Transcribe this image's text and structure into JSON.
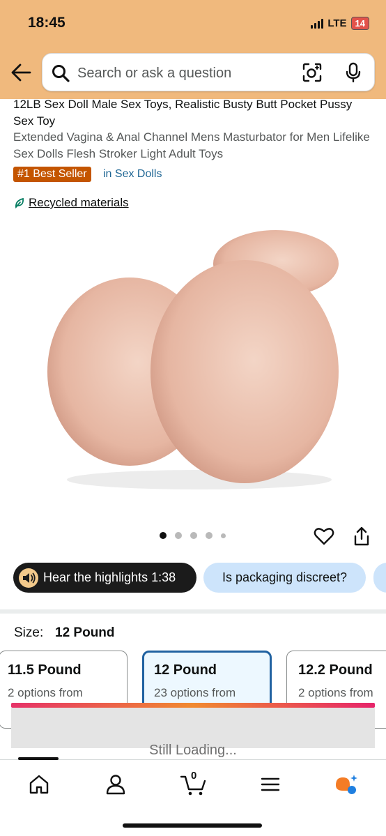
{
  "status_bar": {
    "time": "18:45",
    "network": "LTE",
    "battery": "14"
  },
  "header": {
    "search_placeholder": "Search or ask a question",
    "icons": [
      "back-arrow-icon",
      "search-icon",
      "camera-lens-icon",
      "microphone-icon"
    ]
  },
  "product": {
    "title_main": "12LB Sex Doll Male Sex Toys, Realistic Busty Butt Pocket Pussy Sex Toy",
    "title_detail": "Extended Vagina & Anal Channel Mens Masturbator for Men Lifelike Sex Dolls Flesh Stroker Light Adult Toys",
    "badge": "#1 Best Seller",
    "category_link": "in Sex Dolls",
    "recycled_label": "Recycled materials",
    "image_count": 5,
    "active_image_index": 0,
    "badge_color": "#c45500"
  },
  "chips": {
    "hear_highlights": "Hear the highlights 1:38",
    "question": "Is packaging discreet?"
  },
  "size": {
    "label": "Size:",
    "selected": "12 Pound",
    "options": [
      {
        "name": "11.5 Pound",
        "sub": "2 options from"
      },
      {
        "name": "12 Pound",
        "sub": "23 options from"
      },
      {
        "name": "12.2 Pound",
        "sub": "2 options from"
      }
    ]
  },
  "loading": {
    "text": "Still Loading..."
  },
  "bottom_nav": {
    "cart_count": "0",
    "items": [
      "home-icon",
      "account-icon",
      "cart-icon",
      "menu-icon",
      "rufus-ai-icon"
    ]
  },
  "colors": {
    "header_bg": "#f0b97d",
    "link": "#1f6694",
    "chip_question_bg": "#cde4fb",
    "selected_border": "#2162a1"
  }
}
